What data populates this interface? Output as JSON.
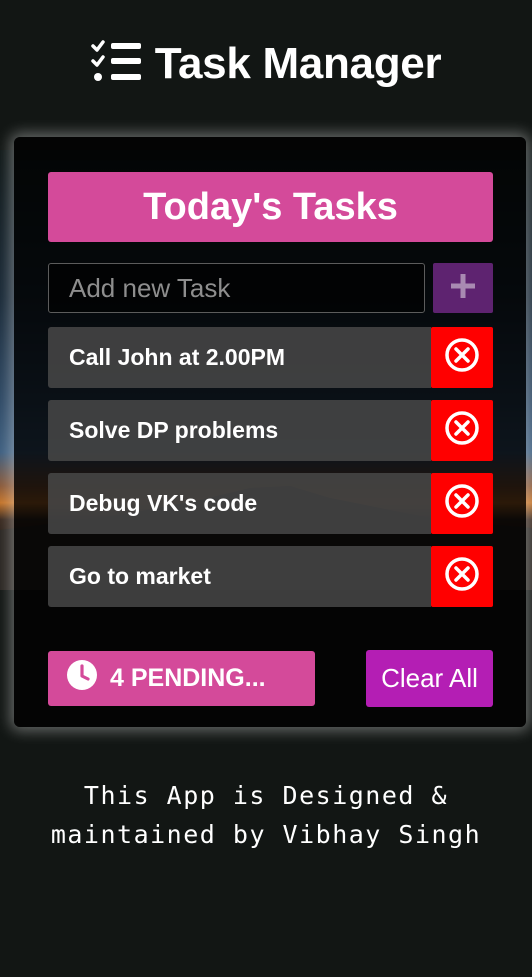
{
  "app": {
    "title": "Task Manager",
    "accent_color": "#d44a9a",
    "header_icon": "checklist-icon"
  },
  "card": {
    "title": "Today's Tasks"
  },
  "new_task": {
    "placeholder": "Add new Task",
    "value": "",
    "add_icon": "plus-icon"
  },
  "tasks": [
    {
      "label": "Call John at 2.00PM",
      "delete_icon": "close-circle-icon"
    },
    {
      "label": "Solve DP problems",
      "delete_icon": "close-circle-icon"
    },
    {
      "label": "Debug VK's code",
      "delete_icon": "close-circle-icon"
    },
    {
      "label": "Go to market",
      "delete_icon": "close-circle-icon"
    }
  ],
  "status": {
    "pending_label": "4 PENDING...",
    "pending_count": 4,
    "clock_icon": "clock-icon",
    "clear_all_label": "Clear All"
  },
  "footer": {
    "line1": "This App is Designed &",
    "line2": "maintained by Vibhay Singh"
  }
}
